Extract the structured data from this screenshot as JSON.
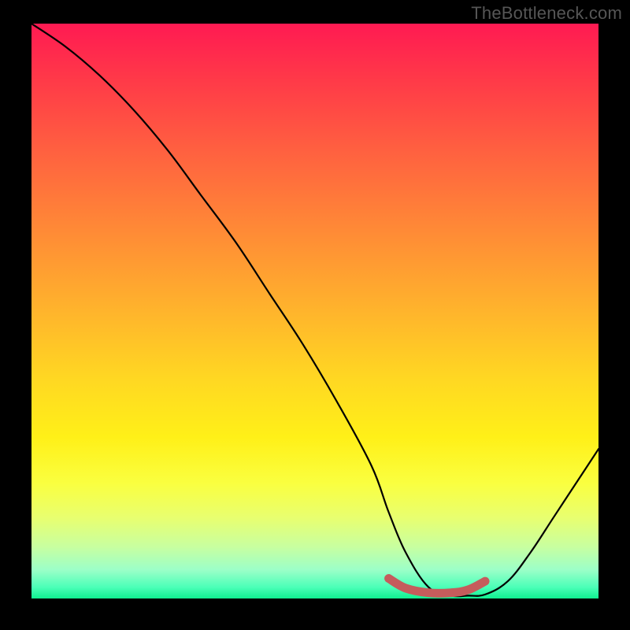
{
  "watermark": "TheBottleneck.com",
  "chart_data": {
    "type": "line",
    "title": "",
    "xlabel": "",
    "ylabel": "",
    "xlim": [
      0,
      100
    ],
    "ylim": [
      0,
      100
    ],
    "series": [
      {
        "name": "curve",
        "x": [
          0,
          6,
          12,
          18,
          24,
          30,
          36,
          42,
          48,
          54,
          60,
          63,
          66,
          70,
          74,
          77,
          80,
          84,
          88,
          92,
          96,
          100
        ],
        "values": [
          100,
          96,
          91,
          85,
          78,
          70,
          62,
          53,
          44,
          34,
          23,
          15,
          8,
          2,
          0.5,
          0.5,
          0.7,
          3,
          8,
          14,
          20,
          26
        ]
      },
      {
        "name": "highlight",
        "x": [
          63,
          66,
          70,
          74,
          77,
          80
        ],
        "values": [
          3.5,
          1.8,
          1,
          1,
          1.5,
          3
        ]
      }
    ],
    "background": "red-to-green vertical gradient (bottleneck heatmap)",
    "highlight_color": "#c55c5c"
  }
}
